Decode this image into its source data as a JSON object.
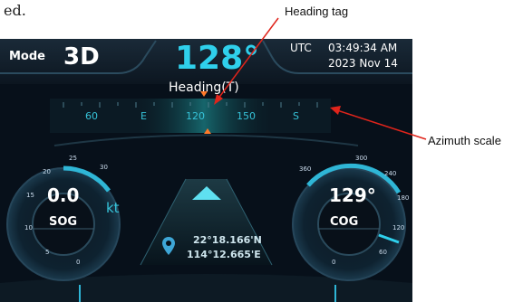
{
  "document": {
    "intro_fragment": "ed."
  },
  "callouts": {
    "heading_tag": "Heading tag",
    "azimuth_scale": "Azimuth scale"
  },
  "header": {
    "mode_label": "Mode",
    "mode_value": "3D",
    "heading_value": "128°",
    "utc_label": "UTC",
    "time": "03:49:34 AM",
    "date": "2023 Nov 14",
    "heading_label": "Heading(T)"
  },
  "azimuth_scale": {
    "labels": [
      "60",
      "E",
      "120",
      "150",
      "S"
    ]
  },
  "sog_gauge": {
    "value": "0.0",
    "unit_label": "SOG",
    "speed_unit": "kt",
    "ticks": [
      "25",
      "30",
      "20",
      "15",
      "10",
      "5",
      "0"
    ]
  },
  "cog_gauge": {
    "value": "129°",
    "unit_label": "COG",
    "ticks": [
      "300",
      "360",
      "240",
      "180",
      "120",
      "60",
      "0"
    ]
  },
  "position": {
    "latitude": "22°18.166'N",
    "longitude": "114°12.665'E"
  },
  "colors": {
    "accent": "#2fd0ec",
    "background": "#07101a",
    "callout_line": "#e0241b",
    "marker": "#ff7a2a"
  },
  "icons": {
    "location": "location-pin-icon",
    "direction": "direction-arrow-icon"
  }
}
